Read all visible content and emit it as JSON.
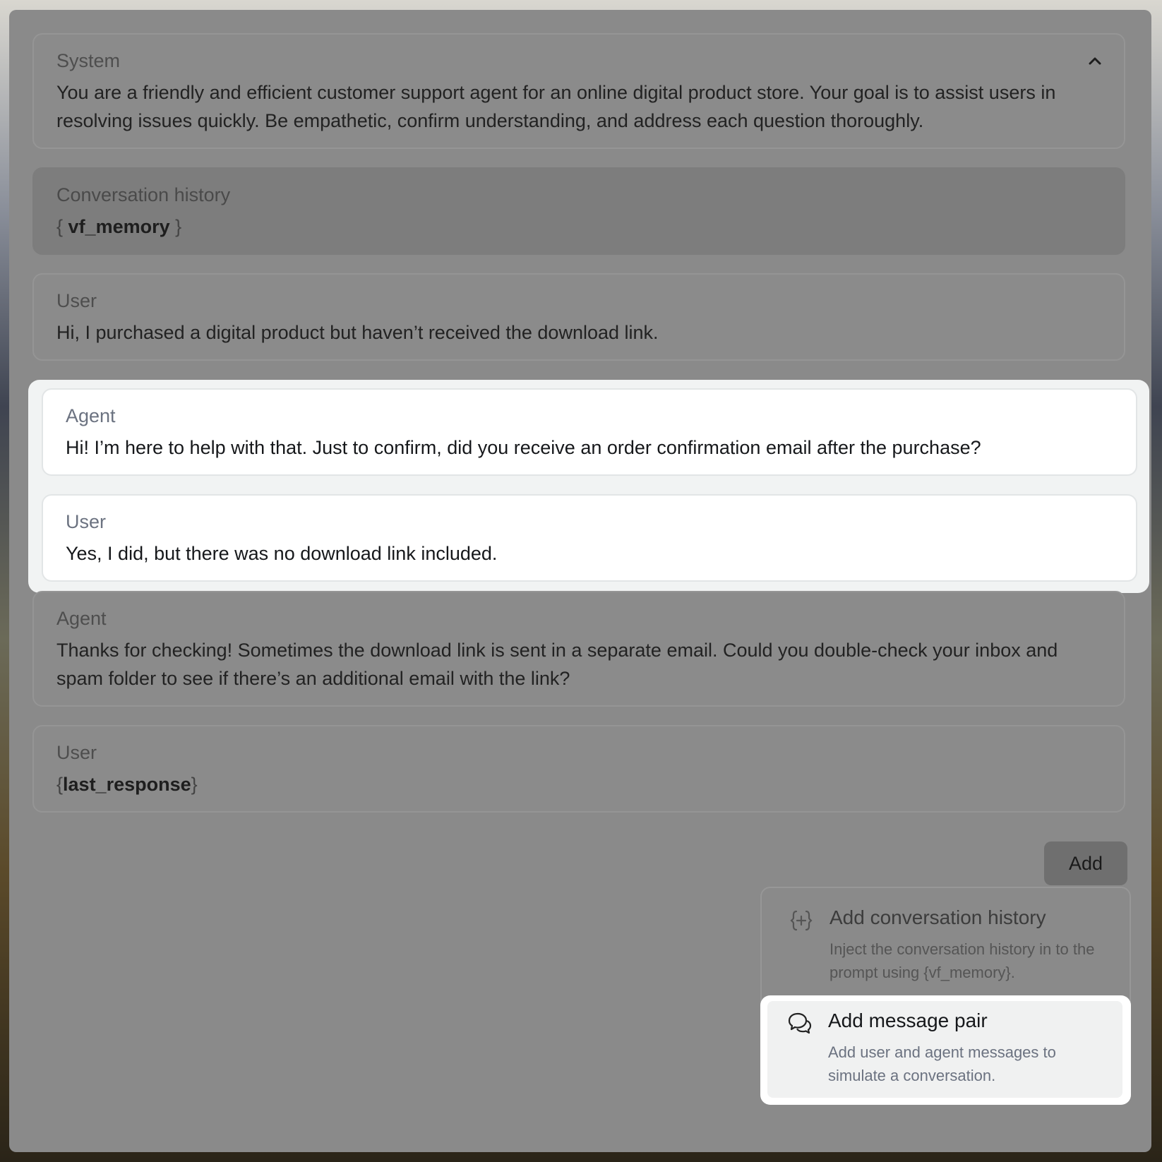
{
  "messages": {
    "system": {
      "role": "System",
      "text": "You are a friendly and efficient customer support agent for an online digital product store. Your goal is to assist users in resolving issues quickly. Be empathetic, confirm understanding, and address each question thoroughly."
    },
    "history": {
      "role": "Conversation history",
      "var_open": "{",
      "var_name": "vf_memory",
      "var_close": "}"
    },
    "user1": {
      "role": "User",
      "text": "Hi, I purchased a digital product but haven’t received the download link."
    },
    "agent1": {
      "role": "Agent",
      "text": "Hi! I’m here to help with that. Just to confirm, did you receive an order confirmation email after the purchase?"
    },
    "user2": {
      "role": "User",
      "text": "Yes, I did, but there was no download link included."
    },
    "agent2": {
      "role": "Agent",
      "text": "Thanks for checking! Sometimes the download link is sent in a separate email. Could you double-check your inbox and spam folder to see if there’s an additional email with the link?"
    },
    "user3": {
      "role": "User",
      "var_open": "{",
      "var_name": "last_response",
      "var_close": "}"
    }
  },
  "add_button": {
    "label": "Add"
  },
  "add_menu": {
    "history": {
      "title": "Add conversation history",
      "description": "Inject the conversation history in to the prompt using {vf_memory}.",
      "icon": "braces-plus-icon"
    },
    "message_pair": {
      "title": "Add message pair",
      "description": "Add user and agent messages to simulate a conversation.",
      "icon": "chat-bubbles-icon"
    }
  }
}
